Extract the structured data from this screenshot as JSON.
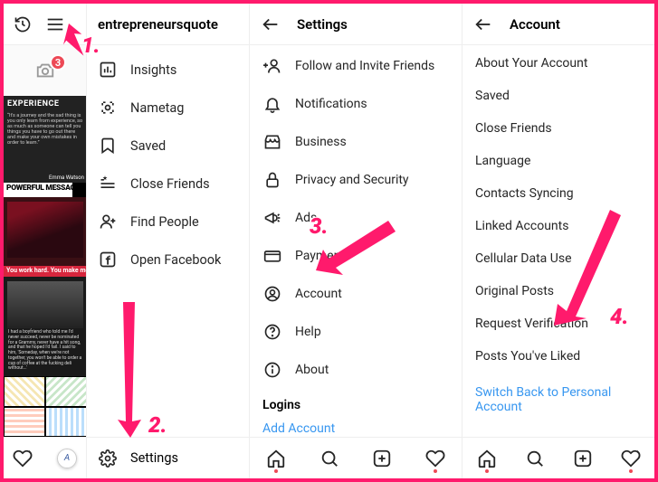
{
  "farLeft": {
    "badgeCount": "3"
  },
  "thumbs": {
    "t1_title": "EXPERIENCE",
    "t1_body": "“It's a journey and the sad thing is you only learn from experience, so as much as someone can tell you things you have to go out there and make your own mistakes in order to learn.”",
    "t1_cap": "Emma Watson",
    "t2_title": "POWERFUL MESSAGE",
    "t2_cap": "You work hard. You make money.",
    "t3_body": "I had a boyfriend who told me I'd never succeed, never be nominated for a Grammy, never have a hit song, and that he hoped I'd fail. I said to him, 'Someday, when we're not together, you won't be able to order a cup of coffee at the fucking deli without...'"
  },
  "profile": {
    "username": "entrepreneursquote",
    "menu": {
      "insights": "Insights",
      "nametag": "Nametag",
      "saved": "Saved",
      "closeFriends": "Close Friends",
      "findPeople": "Find People",
      "openFacebook": "Open Facebook"
    },
    "settings": "Settings"
  },
  "settings": {
    "title": "Settings",
    "items": {
      "follow": "Follow and Invite Friends",
      "notifications": "Notifications",
      "business": "Business",
      "privacy": "Privacy and Security",
      "ads": "Ads",
      "payments": "Payments",
      "account": "Account",
      "help": "Help",
      "about": "About"
    },
    "logins_hdr": "Logins",
    "add_account": "Add Account"
  },
  "account": {
    "title": "Account",
    "items": {
      "about": "About Your Account",
      "saved": "Saved",
      "closeFriends": "Close Friends",
      "language": "Language",
      "contacts": "Contacts Syncing",
      "linked": "Linked Accounts",
      "cellular": "Cellular Data Use",
      "original": "Original Posts",
      "verify": "Request Verification",
      "liked": "Posts You've Liked"
    },
    "switch": "Switch Back to Personal Account"
  },
  "anno": {
    "n1": "1.",
    "n2": "2.",
    "n3": "3.",
    "n4": "4."
  }
}
